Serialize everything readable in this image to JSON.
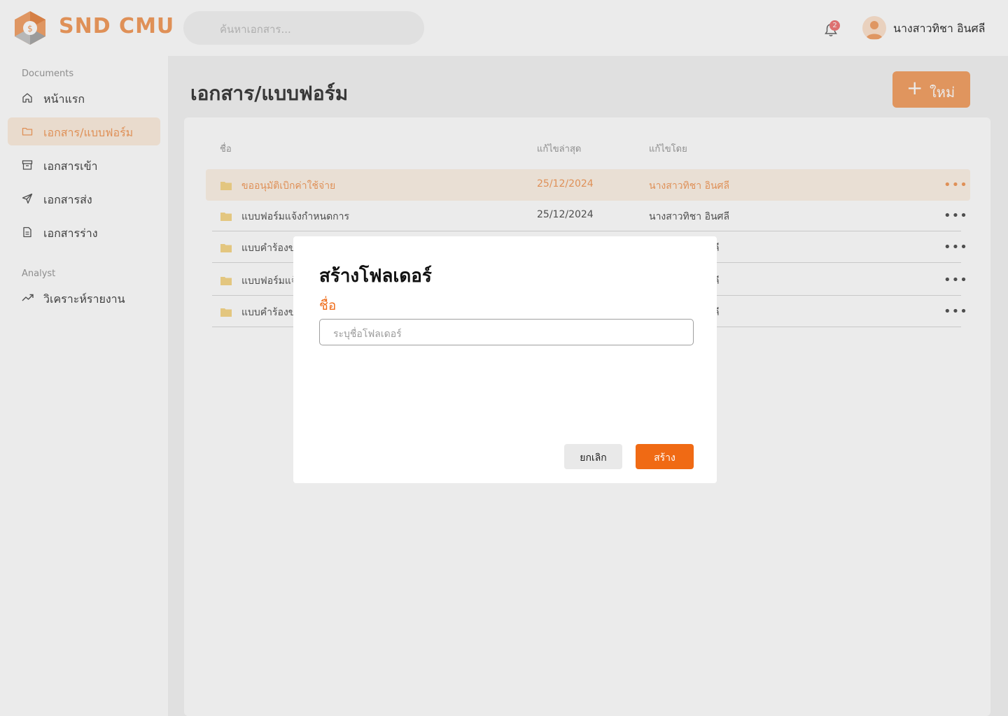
{
  "app": {
    "brand": "SND CMU"
  },
  "header": {
    "search_placeholder": "ค้นหาเอกสาร...",
    "notification_count": "2",
    "user_name": "นางสาวทิชา อินศลี"
  },
  "sidebar": {
    "sections": [
      {
        "label": "Documents"
      },
      {
        "label": "Analyst"
      }
    ],
    "items": [
      {
        "label": "หน้าแรก",
        "icon": "home-icon"
      },
      {
        "label": "เอกสาร/แบบฟอร์ม",
        "icon": "folder-icon",
        "active": true
      },
      {
        "label": "เอกสารเข้า",
        "icon": "inbox-icon"
      },
      {
        "label": "เอกสารส่ง",
        "icon": "send-icon"
      },
      {
        "label": "เอกสารร่าง",
        "icon": "draft-icon"
      },
      {
        "label": "วิเคราะห์รายงาน",
        "icon": "trend-icon"
      }
    ]
  },
  "main": {
    "title": "เอกสาร/แบบฟอร์ม",
    "new_button": "ใหม่",
    "columns": [
      "ชื่อ",
      "แก้ไขล่าสุด",
      "แก้ไขโดย"
    ],
    "rows": [
      {
        "name": "ขออนุมัติเบิกค่าใช้จ่าย",
        "date": "25/12/2024",
        "by": "นางสาวทิชา อินศลี"
      },
      {
        "name": "แบบฟอร์มแจ้งกำหนดการ",
        "date": "25/12/2024",
        "by": "นางสาวทิชา อินศลี"
      },
      {
        "name": "แบบคำร้องขอ",
        "date": "",
        "by": "ลี"
      },
      {
        "name": "แบบฟอร์มแจ้",
        "date": "",
        "by": "ลี"
      },
      {
        "name": "แบบคำร้องขอ",
        "date": "",
        "by": "ลี"
      }
    ]
  },
  "modal": {
    "title": "สร้างโฟลเดอร์",
    "field_label": "ชื่อ",
    "field_placeholder": "ระบุชื่อโฟลเดอร์",
    "cancel_label": "ยกเลิก",
    "create_label": "สร้าง"
  },
  "colors": {
    "accent": "#f29d5f",
    "primary_button": "#f06a14"
  }
}
